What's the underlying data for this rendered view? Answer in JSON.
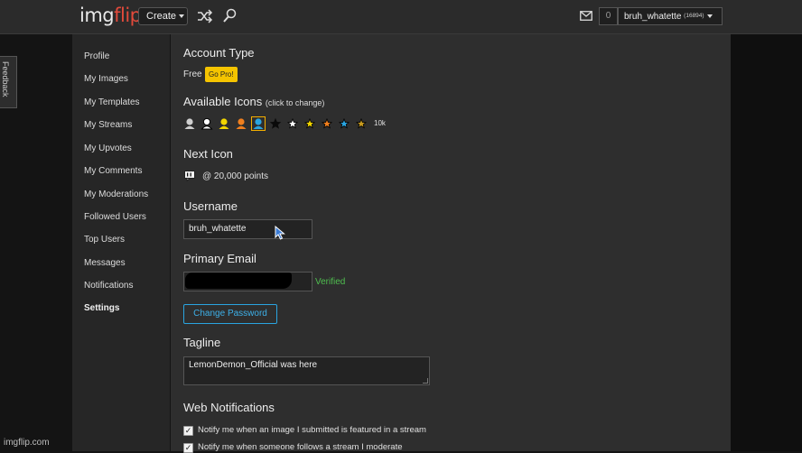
{
  "header": {
    "logo_part1": "img",
    "logo_part2": "flip",
    "create_label": "Create",
    "notification_count": "0",
    "username": "bruh_whatette",
    "user_points": "(16894)"
  },
  "feedback_label": "Feedback",
  "sidebar": {
    "items": [
      {
        "label": "Profile"
      },
      {
        "label": "My Images"
      },
      {
        "label": "My Templates"
      },
      {
        "label": "My Streams"
      },
      {
        "label": "My Upvotes"
      },
      {
        "label": "My Comments"
      },
      {
        "label": "My Moderations"
      },
      {
        "label": "Followed Users"
      },
      {
        "label": "Top Users"
      },
      {
        "label": "Messages"
      },
      {
        "label": "Notifications"
      },
      {
        "label": "Settings"
      }
    ],
    "active_item": "Settings"
  },
  "settings": {
    "account_type_heading": "Account Type",
    "account_type_value": "Free",
    "go_pro_label": "Go Pro!",
    "available_icons_heading": "Available Icons",
    "available_icons_hint": "(click to change)",
    "icons_suffix": "10k",
    "icons": [
      {
        "name": "user-gray",
        "color": "#cfcfcf"
      },
      {
        "name": "user-white",
        "color": "#ffffff"
      },
      {
        "name": "user-yellow",
        "color": "#f2d600"
      },
      {
        "name": "user-orange",
        "color": "#f07f1e"
      },
      {
        "name": "user-blue-selected",
        "color": "#2aa4e0"
      },
      {
        "name": "star-black",
        "color": "#111111"
      },
      {
        "name": "star-white",
        "color": "#ffffff"
      },
      {
        "name": "star-yellow",
        "color": "#f2d600"
      },
      {
        "name": "star-orange",
        "color": "#f07f1e"
      },
      {
        "name": "star-blue",
        "color": "#2aa4e0"
      },
      {
        "name": "star-gold",
        "color": "#c79a1e"
      }
    ],
    "next_icon_heading": "Next Icon",
    "next_icon_points": "@ 20,000 points",
    "username_heading": "Username",
    "username_value": "bruh_whatette",
    "email_heading": "Primary Email",
    "email_status": "Verified",
    "change_password_label": "Change Password",
    "tagline_heading": "Tagline",
    "tagline_value": "LemonDemon_Official was here",
    "web_notifications_heading": "Web Notifications",
    "notifications": [
      {
        "label": "Notify me when an image I submitted is featured in a stream",
        "checked": true
      },
      {
        "label": "Notify me when someone follows a stream I moderate",
        "checked": true
      }
    ]
  },
  "watermark": "imgflip.com"
}
